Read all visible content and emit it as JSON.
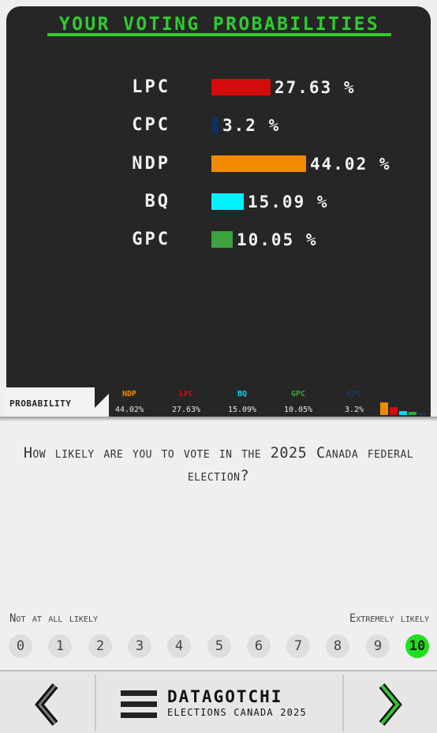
{
  "panel": {
    "title": "YOUR VOTING PROBABILITIES",
    "rows": [
      {
        "party": "LPC",
        "pct": "27.63 %",
        "value": 27.63,
        "color": "#d50a0a"
      },
      {
        "party": "CPC",
        "pct": "3.2 %",
        "value": 3.2,
        "color": "#0f2f5e"
      },
      {
        "party": "NDP",
        "pct": "44.02 %",
        "value": 44.02,
        "color": "#f28a00"
      },
      {
        "party": "BQ",
        "pct": "15.09 %",
        "value": 15.09,
        "color": "#00f2ff"
      },
      {
        "party": "GPC",
        "pct": "10.05 %",
        "value": 10.05,
        "color": "#3da33d"
      }
    ]
  },
  "strip": {
    "label": "PROBABILITY",
    "items": [
      {
        "name": "NDP",
        "value": "44.02%",
        "color": "#f28a00"
      },
      {
        "name": "LPC",
        "value": "27.63%",
        "color": "#d50a0a"
      },
      {
        "name": "BQ",
        "value": "15.09%",
        "color": "#00d8ff"
      },
      {
        "name": "GPC",
        "value": "10.05%",
        "color": "#3da33d"
      },
      {
        "name": "CPC",
        "value": "3.2%",
        "color": "#1e3a66"
      }
    ]
  },
  "question": {
    "text": "How likely are you to vote in the 2025 Canada federal election?",
    "low_label": "Not at all likely",
    "high_label": "Extremely likely",
    "options": [
      "0",
      "1",
      "2",
      "3",
      "4",
      "5",
      "6",
      "7",
      "8",
      "9",
      "10"
    ],
    "selected": "10"
  },
  "footer": {
    "brand_title": "DATAGOTCHI",
    "brand_subtitle": "ELECTIONS CANADA 2025",
    "prev_icon": "chevron-left-icon",
    "next_icon": "chevron-right-icon",
    "menu_icon": "hamburger-menu-icon",
    "accent": "#2ecc2e"
  }
}
